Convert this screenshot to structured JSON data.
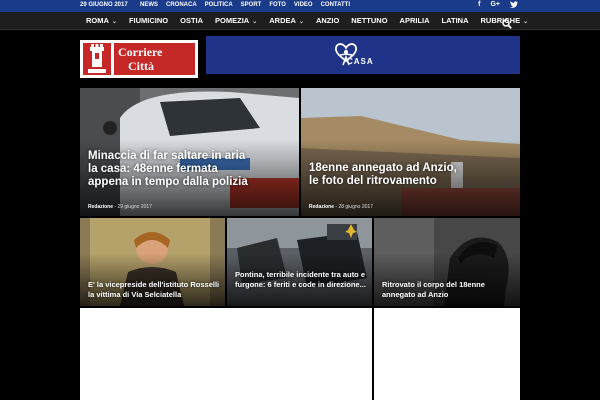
{
  "topbar": {
    "date": "29 GIUGNO 2017",
    "links": [
      "NEWS",
      "CRONACA",
      "POLITICA",
      "SPORT",
      "FOTO",
      "VIDEO",
      "CONTATTI"
    ],
    "social_icons": [
      "facebook-icon",
      "google-plus-icon",
      "twitter-icon"
    ]
  },
  "nav": {
    "items": [
      {
        "label": "ROMA",
        "dropdown": true
      },
      {
        "label": "FIUMICINO",
        "dropdown": false
      },
      {
        "label": "OSTIA",
        "dropdown": false
      },
      {
        "label": "POMEZIA",
        "dropdown": true
      },
      {
        "label": "ARDEA",
        "dropdown": true
      },
      {
        "label": "ANZIO",
        "dropdown": false
      },
      {
        "label": "NETTUNO",
        "dropdown": false
      },
      {
        "label": "APRILIA",
        "dropdown": false
      },
      {
        "label": "LATINA",
        "dropdown": false
      },
      {
        "label": "RUBRICHE",
        "dropdown": true
      }
    ],
    "search_icon": "search-icon"
  },
  "header": {
    "logo_line1": "Corriere",
    "logo_line2": "Città",
    "banner_text": "CASA"
  },
  "articles": [
    {
      "title": "Minaccia di far saltare in aria la casa: 48enne fermata appena in tempo dalla polizia",
      "author": "Redazione",
      "date": "29 giugno 2017"
    },
    {
      "title": "18enne annegato ad Anzio, le foto del ritrovamento",
      "author": "Redazione",
      "date": "28 giugno 2017"
    },
    {
      "title": "E' la vicepreside dell'istituto Rosselli la vittima di Via Selciatella"
    },
    {
      "title": "Pontina, terribile incidente tra auto e furgone: 6 feriti e code in direzione..."
    },
    {
      "title": "Ritrovato il corpo del 18enne annegato ad Anzio"
    }
  ],
  "colors": {
    "topbar": "#1a3a8a",
    "nav": "#1e1e1e",
    "logo_red": "#c62828",
    "banner_blue": "#1f3488"
  }
}
